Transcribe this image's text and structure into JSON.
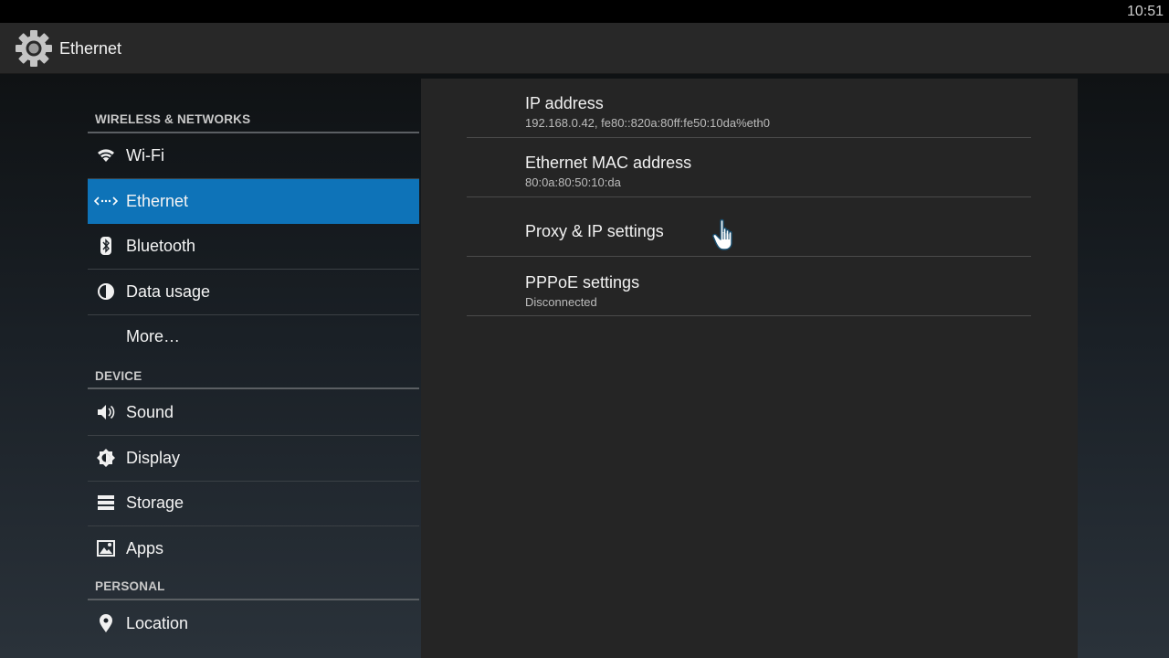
{
  "status_bar": {
    "time": "10:51"
  },
  "action_bar": {
    "title": "Ethernet",
    "icon": "settings-gear-icon"
  },
  "sidebar": {
    "sections": [
      {
        "header": "WIRELESS & NETWORKS",
        "items": [
          {
            "label": "Wi-Fi",
            "icon": "wifi-icon"
          },
          {
            "label": "Ethernet",
            "icon": "ethernet-icon",
            "selected": true
          },
          {
            "label": "Bluetooth",
            "icon": "bluetooth-icon"
          },
          {
            "label": "Data usage",
            "icon": "data-usage-icon"
          },
          {
            "label": "More…",
            "icon": ""
          }
        ]
      },
      {
        "header": "DEVICE",
        "items": [
          {
            "label": "Sound",
            "icon": "speaker-icon"
          },
          {
            "label": "Display",
            "icon": "brightness-icon"
          },
          {
            "label": "Storage",
            "icon": "storage-icon"
          },
          {
            "label": "Apps",
            "icon": "apps-icon"
          }
        ]
      },
      {
        "header": "PERSONAL",
        "items": [
          {
            "label": "Location",
            "icon": "location-pin-icon"
          }
        ]
      }
    ]
  },
  "detail": {
    "rows": [
      {
        "title": "IP address",
        "summary": "192.168.0.42, fe80::820a:80ff:fe50:10da%eth0"
      },
      {
        "title": "Ethernet MAC address",
        "summary": "80:0a:80:50:10:da"
      },
      {
        "title": "Proxy & IP settings",
        "summary": ""
      },
      {
        "title": "PPPoE settings",
        "summary": "Disconnected"
      }
    ]
  },
  "colors": {
    "selected": "#0e73b8",
    "panel": "#252525",
    "action_bar": "#282828"
  }
}
